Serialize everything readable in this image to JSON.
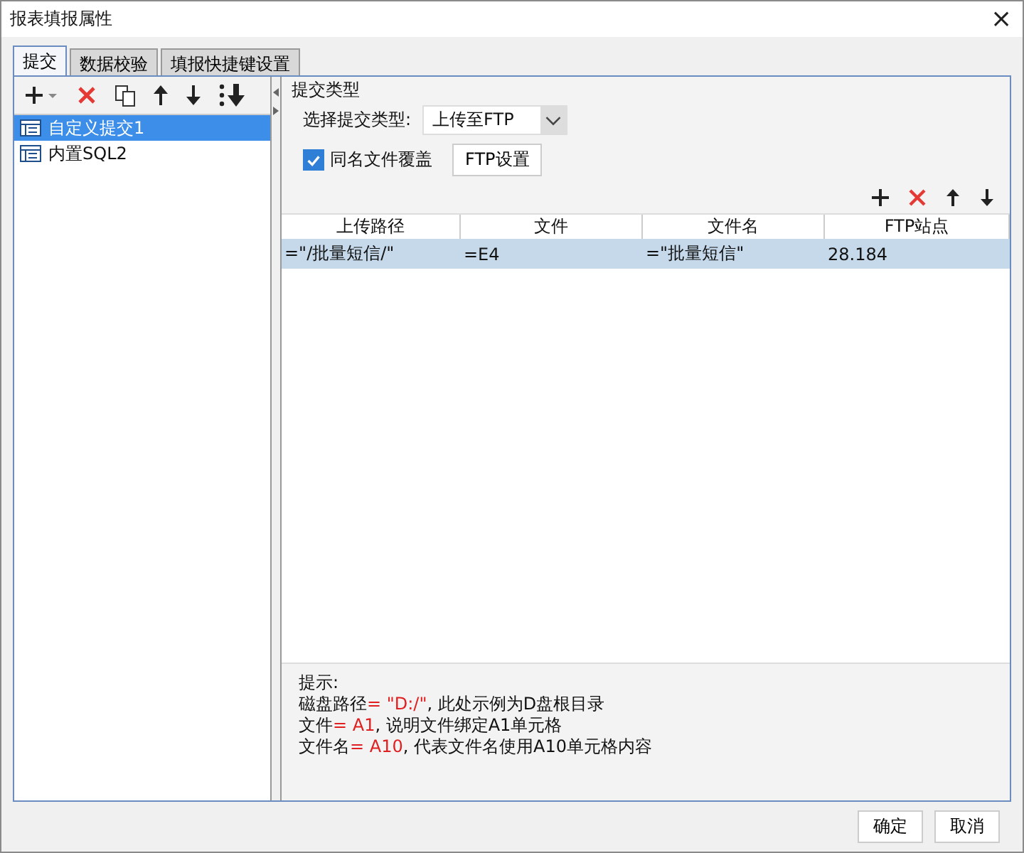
{
  "window": {
    "title": "报表填报属性",
    "close": "×"
  },
  "tabs": [
    {
      "label": "提交",
      "selected": true
    },
    {
      "label": "数据校验",
      "selected": false
    },
    {
      "label": "填报快捷键设置",
      "selected": false
    }
  ],
  "submissions": [
    {
      "label": "自定义提交1",
      "selected": true
    },
    {
      "label": "内置SQL2",
      "selected": false
    }
  ],
  "submit_type": {
    "group_title": "提交类型",
    "type_label": "选择提交类型:",
    "type_value": "上传至FTP",
    "overwrite": {
      "label": "同名文件覆盖",
      "checked": true
    },
    "ftp_button": "FTP设置"
  },
  "table": {
    "columns": [
      "上传路径",
      "文件",
      "文件名",
      "FTP站点"
    ],
    "rows": [
      {
        "cells": [
          "=\"/批量短信/\"",
          "=E4",
          "=\"批量短信\"",
          "28.184"
        ],
        "selected": true
      }
    ]
  },
  "hints": {
    "title": "提示:",
    "lines": [
      [
        {
          "text": "磁盘路径",
          "kind": "plain"
        },
        {
          "text": "= \"D:/\"",
          "kind": "code"
        },
        {
          "text": ", 此处示例为D盘根目录",
          "kind": "plain"
        }
      ],
      [
        {
          "text": "文件",
          "kind": "plain"
        },
        {
          "text": "= A1",
          "kind": "code"
        },
        {
          "text": ", 说明文件绑定A1单元格",
          "kind": "plain"
        }
      ],
      [
        {
          "text": "文件名",
          "kind": "plain"
        },
        {
          "text": "= A10",
          "kind": "code"
        },
        {
          "text": ", 代表文件名使用A10单元格内容",
          "kind": "plain"
        }
      ]
    ]
  },
  "buttons": [
    "确定",
    "取消"
  ]
}
